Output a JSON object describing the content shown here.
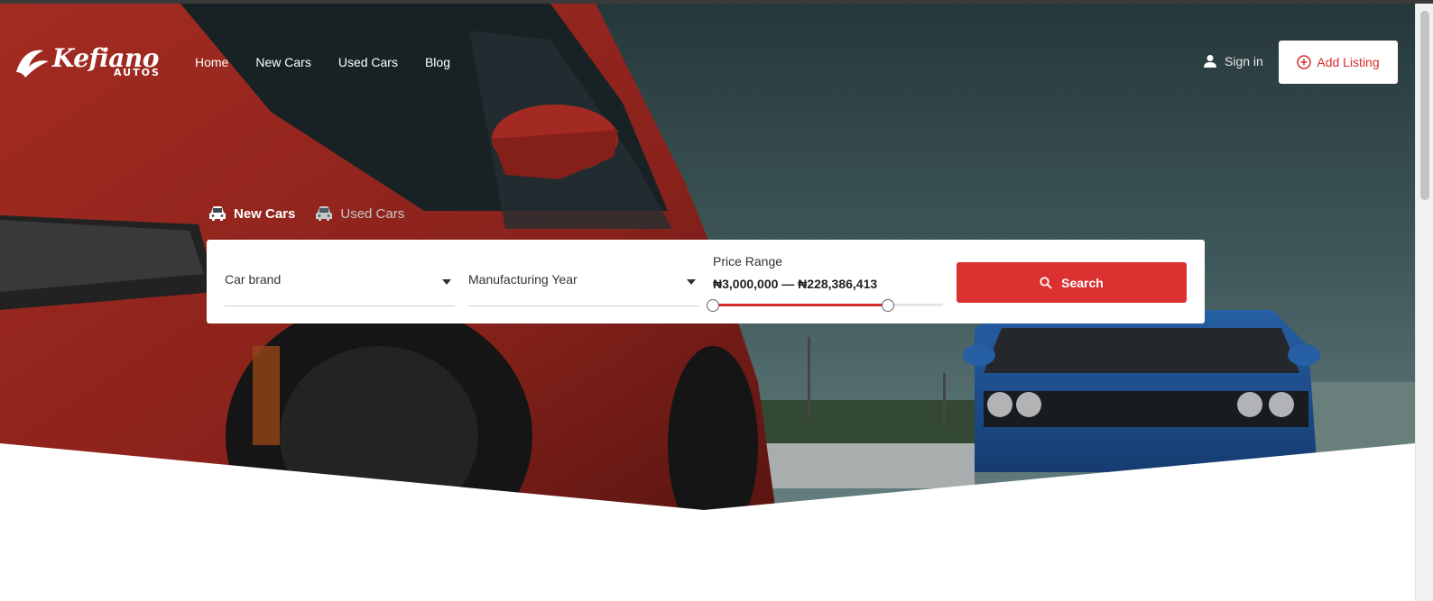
{
  "brand": {
    "logo_text": "Kefiano",
    "logo_sub": "AUTOS"
  },
  "nav": {
    "items": [
      {
        "label": "Home"
      },
      {
        "label": "New Cars"
      },
      {
        "label": "Used Cars"
      },
      {
        "label": "Blog"
      }
    ]
  },
  "header": {
    "signin_label": "Sign in",
    "add_listing_label": "Add Listing"
  },
  "search": {
    "tabs": [
      {
        "label": "New Cars",
        "active": true
      },
      {
        "label": "Used Cars",
        "active": false
      }
    ],
    "car_brand_label": "Car brand",
    "year_label": "Manufacturing Year",
    "price_label": "Price Range",
    "price_value": "₦3,000,000 — ₦228,386,413",
    "price_slider": {
      "min_fraction": 0.0,
      "max_fraction": 0.76
    },
    "button_label": "Search"
  },
  "icons": {
    "user": "user-icon",
    "add": "plus-circle-icon",
    "car": "car-icon",
    "search": "search-icon",
    "caret": "caret-down-icon"
  },
  "colors": {
    "accent": "#dc3131",
    "white": "#ffffff"
  }
}
